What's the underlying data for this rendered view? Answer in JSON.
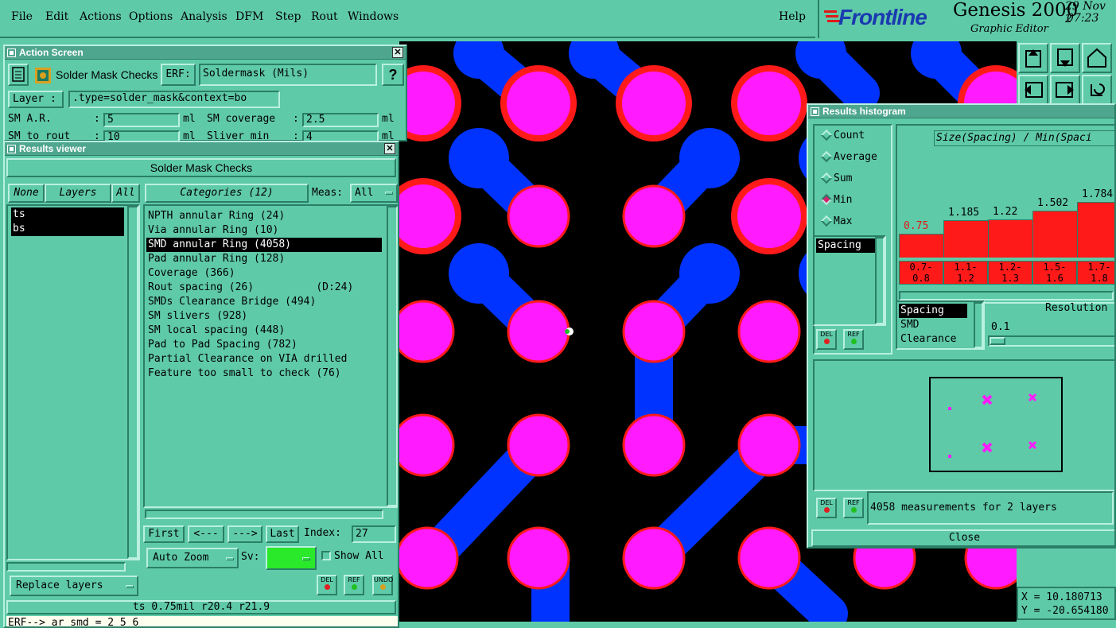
{
  "menu": [
    "File",
    "Edit",
    "Actions",
    "Options",
    "Analysis",
    "DFM",
    "Step",
    "Rout",
    "Windows"
  ],
  "help": "Help",
  "brand": {
    "logo": "Frontline",
    "product": "Genesis 2000",
    "subtitle": "Graphic Editor",
    "date": "29 Nov 2",
    "time": "07:23"
  },
  "action_screen": {
    "title": "Action Screen",
    "check_name": "Solder Mask Checks",
    "erf_label": "ERF:",
    "erf_value": "Soldermask (Mils)",
    "help_btn": "?",
    "layer_label": "Layer :",
    "layer_value": ".type=solder_mask&context=bo",
    "params": [
      {
        "label": "SM A.R.",
        "sep": ":",
        "value": "5",
        "unit": "ml"
      },
      {
        "label": "SM coverage",
        "sep": ":",
        "value": "2.5",
        "unit": "ml"
      },
      {
        "label": "SM to rout",
        "sep": ":",
        "value": "10",
        "unit": "ml"
      },
      {
        "label": "Sliver  min",
        "sep": ":",
        "value": "4",
        "unit": "ml"
      }
    ]
  },
  "results_viewer": {
    "title": "Results viewer",
    "header": "Solder Mask Checks",
    "none_btn": "None",
    "layers_btn": "Layers",
    "all_btn": "All",
    "categories_btn": "Categories (12)",
    "meas_label": "Meas:",
    "meas_value": "All",
    "layers": [
      "ts",
      "bs"
    ],
    "categories": [
      "NPTH annular Ring (24)",
      "Via annular Ring (10)",
      "SMD annular Ring (4058)",
      "Pad annular Ring (128)",
      "Coverage (366)",
      "Rout spacing (26)          (D:24)",
      "SMDs Clearance Bridge (494)",
      "SM slivers (928)",
      "SM local spacing (448)",
      "Pad to Pad Spacing (782)",
      "Partial Clearance on VIA drilled",
      "Feature too small to check (76)"
    ],
    "selected_category": 2,
    "first_btn": "First",
    "prev_btn": "<---",
    "next_btn": "--->",
    "last_btn": "Last",
    "index_label": "Index:",
    "index_value": "27",
    "auto_zoom": "Auto Zoom",
    "sv_label": "Sv:",
    "show_all": "Show All",
    "replace_layers": "Replace layers",
    "del": "DEL",
    "ref": "REF",
    "undo": "UNDO",
    "status": "ts 0.75mil  r20.4  r21.9",
    "erf_line": "ERF--> ar_smd = 2 5 6"
  },
  "histogram": {
    "title": "Results histogram",
    "modes": [
      "Count",
      "Average",
      "Sum",
      "Min",
      "Max"
    ],
    "selected_mode": 3,
    "chart_title": "Size(Spacing) / Min(Spaci",
    "measure_list": [
      "Spacing"
    ],
    "values": [
      "0.75",
      "1.185",
      "1.22",
      "1.502",
      "1.784"
    ],
    "bar_values": [
      0.75,
      1.185,
      1.22,
      1.502,
      1.784
    ],
    "bins": [
      "0.7-\n0.8",
      "1.1-\n1.2",
      "1.2-\n1.3",
      "1.5-\n1.6",
      "1.7-\n1.8"
    ],
    "attr_list": [
      "Spacing",
      "SMD",
      "Clearance"
    ],
    "resolution_label": "Resolution",
    "resolution_value": "0.1",
    "del": "DEL",
    "ref": "REF",
    "summary": "4058 measurements for 2 layers",
    "close": "Close"
  },
  "coords": {
    "x": "X =  10.180713",
    "y": "Y = -20.654180"
  },
  "colors": {
    "bg": "#5fcaa8",
    "pad": "#ff1aff",
    "pad_ring": "#ff1a1a",
    "trace": "#0033ff",
    "canvas": "#000000",
    "bar": "#ff1a1a",
    "select": "#000000"
  }
}
